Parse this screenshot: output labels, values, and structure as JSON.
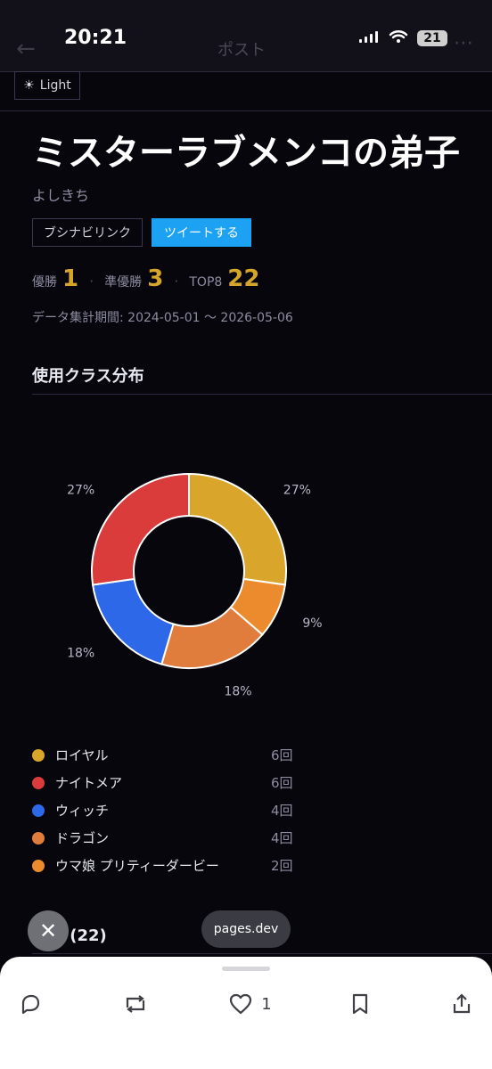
{
  "status_bar": {
    "time": "20:21",
    "battery": "21"
  },
  "header": {
    "back_icon": "back-arrow-icon",
    "title": "ポスト",
    "more_icon": "more-icon"
  },
  "theme_toggle": {
    "label": "Light",
    "icon": "sun-icon"
  },
  "profile": {
    "title": "ミスターラブメンコの弟子",
    "author": "よしきち"
  },
  "buttons": {
    "busnavi": "ブシナビリンク",
    "tweet": "ツイートする"
  },
  "stats": {
    "win_label": "優勝",
    "win_value": "1",
    "runner_label": "準優勝",
    "runner_value": "3",
    "top8_label": "TOP8",
    "top8_value": "22"
  },
  "period": "データ集計期間: 2024-05-01 〜 2026-05-06",
  "class_section": {
    "title": "使用クラス分布"
  },
  "chart_data": {
    "type": "pie",
    "donut": true,
    "title": "",
    "slices": [
      {
        "label": "ロイヤル",
        "value": 6,
        "percent": "27%",
        "color": "#D9A62B"
      },
      {
        "label": "ウマ娘 プリティーダービー",
        "value": 2,
        "percent": "9%",
        "color": "#EB8B2E"
      },
      {
        "label": "ドラゴン",
        "value": 4,
        "percent": "18%",
        "color": "#E07D3D"
      },
      {
        "label": "ウィッチ",
        "value": 4,
        "percent": "18%",
        "color": "#2D68E8"
      },
      {
        "label": "ナイトメア",
        "value": 6,
        "percent": "27%",
        "color": "#DA3B3B"
      }
    ]
  },
  "legend": [
    {
      "name": "ロイヤル",
      "count": "6回",
      "color": "#D9A62B"
    },
    {
      "name": "ナイトメア",
      "count": "6回",
      "color": "#DA3B3B"
    },
    {
      "name": "ウィッチ",
      "count": "4回",
      "color": "#2D68E8"
    },
    {
      "name": "ドラゴン",
      "count": "4回",
      "color": "#E07D3D"
    },
    {
      "name": "ウマ娘 プリティーダービー",
      "count": "2回",
      "color": "#EB8B2E"
    }
  ],
  "results_section": {
    "title": "成績 (22)"
  },
  "overlay": {
    "close_icon": "close-icon",
    "domain": "pages.dev"
  },
  "bottom_bar": {
    "reply_icon": "reply-icon",
    "repost_icon": "repost-icon",
    "like_icon": "heart-icon",
    "like_count": "1",
    "bookmark_icon": "bookmark-icon",
    "share_icon": "share-icon"
  }
}
